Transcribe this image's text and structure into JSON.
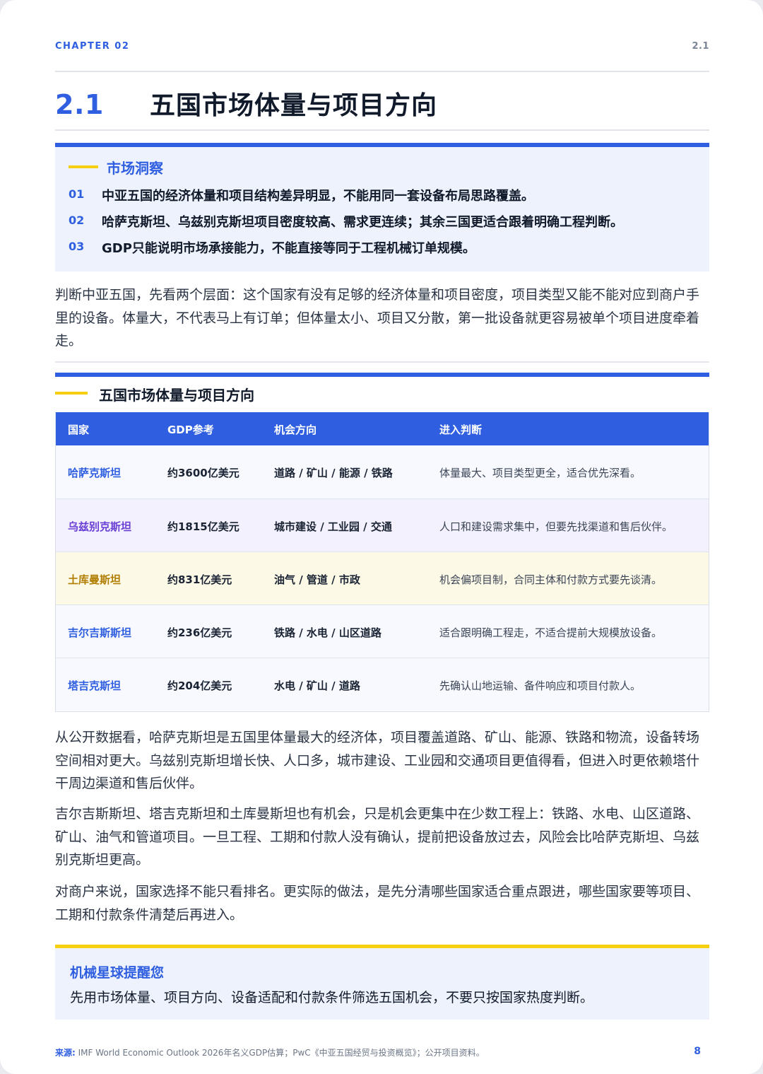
{
  "header": {
    "chapter": "CHAPTER 02",
    "section_ref": "2.1",
    "section_number": "2.1",
    "title": "五国市场体量与项目方向"
  },
  "insight": {
    "heading": "市场洞察",
    "items": [
      {
        "num": "01",
        "text": "中亚五国的经济体量和项目结构差异明显，不能用同一套设备布局思路覆盖。"
      },
      {
        "num": "02",
        "text": "哈萨克斯坦、乌兹别克斯坦项目密度较高、需求更连续；其余三国更适合跟着明确工程判断。"
      },
      {
        "num": "03",
        "text": "GDP只能说明市场承接能力，不能直接等同于工程机械订单规模。"
      }
    ]
  },
  "intro": "判断中亚五国，先看两个层面：这个国家有没有足够的经济体量和项目密度，项目类型又能不能对应到商户手里的设备。体量大，不代表马上有订单；但体量太小、项目又分散，第一批设备就更容易被单个项目进度牵着走。",
  "table": {
    "title": "五国市场体量与项目方向",
    "columns": [
      "国家",
      "GDP参考",
      "机会方向",
      "进入判断"
    ],
    "rows": [
      {
        "country": "哈萨克斯坦",
        "gdp": "约3600亿美元",
        "direction": "道路 / 矿山 / 能源 / 铁路",
        "judgement": "体量最大、项目类型更全，适合优先深看。",
        "bg": "#f7f9fe",
        "color": "#2f5fe0"
      },
      {
        "country": "乌兹别克斯坦",
        "gdp": "约1815亿美元",
        "direction": "城市建设 / 工业园 / 交通",
        "judgement": "人口和建设需求集中，但要先找渠道和售后伙伴。",
        "bg": "#f3f1fd",
        "color": "#6a3fd6"
      },
      {
        "country": "土库曼斯坦",
        "gdp": "约831亿美元",
        "direction": "油气 / 管道 / 市政",
        "judgement": "机会偏项目制，合同主体和付款方式要先谈清。",
        "bg": "#fdf9e7",
        "color": "#b07d00"
      },
      {
        "country": "吉尔吉斯斯坦",
        "gdp": "约236亿美元",
        "direction": "铁路 / 水电 / 山区道路",
        "judgement": "适合跟明确工程走，不适合提前大规模放设备。",
        "bg": "#f7f9fe",
        "color": "#2f5fe0"
      },
      {
        "country": "塔吉克斯坦",
        "gdp": "约204亿美元",
        "direction": "水电 / 矿山 / 道路",
        "judgement": "先确认山地运输、备件响应和项目付款人。",
        "bg": "#f7f9fe",
        "color": "#2f5fe0"
      }
    ]
  },
  "body": {
    "p1": "从公开数据看，哈萨克斯坦是五国里体量最大的经济体，项目覆盖道路、矿山、能源、铁路和物流，设备转场空间相对更大。乌兹别克斯坦增长快、人口多，城市建设、工业园和交通项目更值得看，但进入时更依赖塔什干周边渠道和售后伙伴。",
    "p2": "吉尔吉斯斯坦、塔吉克斯坦和土库曼斯坦也有机会，只是机会更集中在少数工程上：铁路、水电、山区道路、矿山、油气和管道项目。一旦工程、工期和付款人没有确认，提前把设备放过去，风险会比哈萨克斯坦、乌兹别克斯坦更高。",
    "p3": "对商户来说，国家选择不能只看排名。更实际的做法，是先分清哪些国家适合重点跟进，哪些国家要等项目、工期和付款条件清楚后再进入。"
  },
  "reminder": {
    "heading": "机械星球提醒您",
    "text": "先用市场体量、项目方向、设备适配和付款条件筛选五国机会，不要只按国家热度判断。"
  },
  "footer": {
    "source_label": "来源:",
    "source_text": "IMF World Economic Outlook 2026年名义GDP估算；PwC《中亚五国经贸与投资概览》；公开项目资料。",
    "page": "8"
  },
  "colors": {
    "accent": "#2f5fe0",
    "highlight": "#f5cf10",
    "panel": "#edf2fc"
  }
}
